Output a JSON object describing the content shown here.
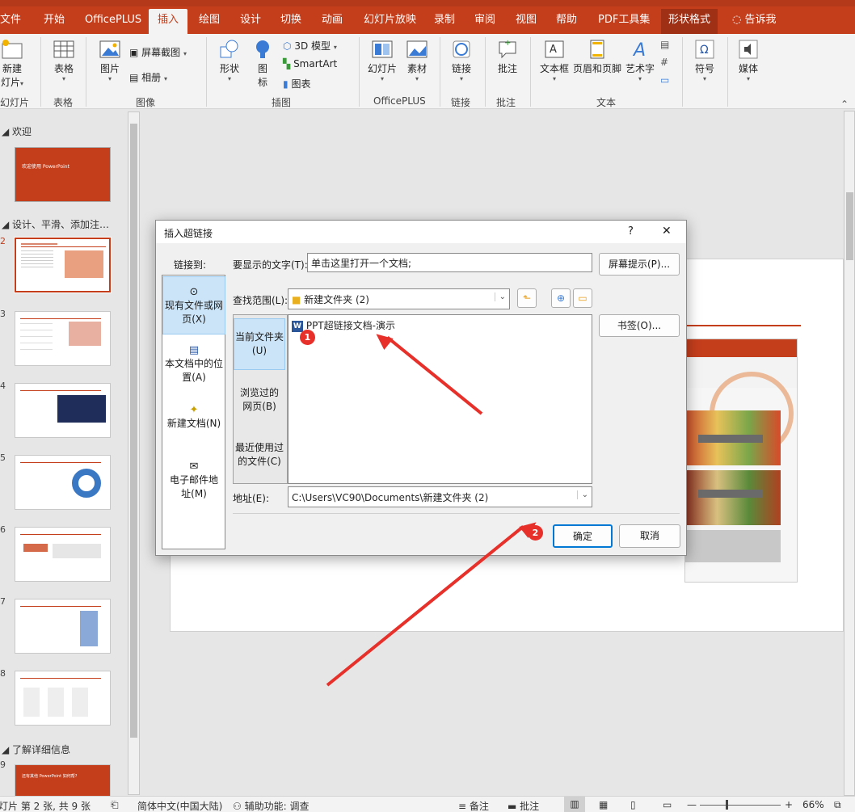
{
  "ribbon": {
    "tabs": [
      "文件",
      "开始",
      "OfficePLUS",
      "插入",
      "绘图",
      "设计",
      "切换",
      "动画",
      "幻灯片放映",
      "录制",
      "审阅",
      "视图",
      "帮助",
      "PDF工具集",
      "形状格式"
    ],
    "tell_me": "告诉我",
    "buttons": {
      "new_slide": "新建",
      "new_slide_2": "灯片",
      "table": "表格",
      "picture": "图片",
      "screenshot": "屏幕截图",
      "album": "相册",
      "shapes": "形状",
      "icons": "图",
      "icons_2": "标",
      "model3d": "3D 模型",
      "smartart": "SmartArt",
      "chart": "图表",
      "slides": "幻灯片",
      "materials": "素材",
      "link": "链接",
      "comment": "批注",
      "textbox": "文本框",
      "header_footer": "页眉和页脚",
      "wordart": "艺术字",
      "symbol": "符号",
      "media": "媒体"
    },
    "groups": [
      "幻灯片",
      "表格",
      "图像",
      "插图",
      "OfficePLUS",
      "链接",
      "批注",
      "文本"
    ]
  },
  "thumbnails": {
    "sections": [
      "欢迎",
      "设计、平滑、添加注…",
      "了解详细信息"
    ],
    "numbers": [
      "2",
      "3",
      "4",
      "5",
      "6",
      "7",
      "8",
      "9"
    ],
    "slide1_title": "欢迎使用 PowerPoint",
    "slide1_sub": "",
    "slide9_title": "还有其他 PowerPoint 如何帮?"
  },
  "dialog": {
    "title": "插入超链接",
    "help": "?",
    "close": "✕",
    "link_to_label": "链接到:",
    "link_to": [
      "现有文件或网页(X)",
      "本文档中的位置(A)",
      "新建文档(N)",
      "电子邮件地址(M)"
    ],
    "display_text_label": "要显示的文字(T):",
    "display_text_value": "单击这里打开一个文档;",
    "screentip_button": "屏幕提示(P)...",
    "look_in_label": "查找范围(L):",
    "look_in_value": "新建文件夹 (2)",
    "tabs": [
      "当前文件夹(U)",
      "浏览过的网页(B)",
      "最近使用过的文件(C)"
    ],
    "files": [
      "PPT超链接文档-演示"
    ],
    "bookmark_button": "书签(O)...",
    "address_label": "地址(E):",
    "address_value": "C:\\Users\\VC90\\Documents\\新建文件夹 (2)",
    "ok": "确定",
    "cancel": "取消"
  },
  "annotations": {
    "badge1": "1",
    "badge2": "2",
    "color": "#e8302a"
  },
  "statusbar": {
    "slide_info": "灯片 第 2 张, 共 9 张",
    "language": "简体中文(中国大陆)",
    "accessibility": "辅助功能: 调查",
    "notes": "备注",
    "comments": "批注",
    "zoom": "66%"
  },
  "colors": {
    "accent": "#c43e1c",
    "selection": "#cce4f7"
  }
}
